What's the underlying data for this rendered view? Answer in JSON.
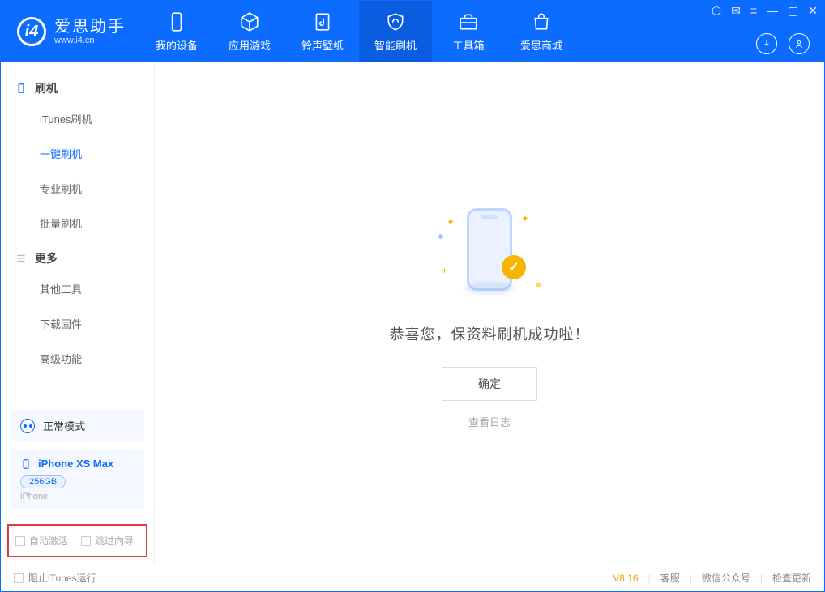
{
  "app": {
    "name_cn": "爱思助手",
    "name_en": "www.i4.cn"
  },
  "tabs": [
    {
      "label": "我的设备"
    },
    {
      "label": "应用游戏"
    },
    {
      "label": "铃声壁纸"
    },
    {
      "label": "智能刷机"
    },
    {
      "label": "工具箱"
    },
    {
      "label": "爱思商城"
    }
  ],
  "sidebar": {
    "section1": "刷机",
    "items1": [
      "iTunes刷机",
      "一键刷机",
      "专业刷机",
      "批量刷机"
    ],
    "section2": "更多",
    "items2": [
      "其他工具",
      "下载固件",
      "高级功能"
    ]
  },
  "mode": {
    "label": "正常模式"
  },
  "device": {
    "name": "iPhone XS Max",
    "storage": "256GB",
    "model": "iPhone"
  },
  "options": {
    "auto_activate": "自动激活",
    "skip_guide": "跳过向导"
  },
  "main": {
    "message": "恭喜您，保资料刷机成功啦！",
    "ok": "确定",
    "view_log": "查看日志"
  },
  "status": {
    "block_itunes": "阻止iTunes运行",
    "version": "V8.16",
    "support": "客服",
    "wechat": "微信公众号",
    "update": "检查更新"
  }
}
